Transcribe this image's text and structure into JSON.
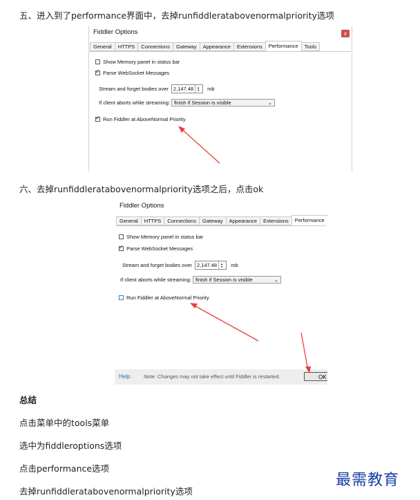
{
  "steps": {
    "five": "五、进入到了performance界面中，去掉runfiddleratabovenormalpriority选项",
    "six": "六、去掉runfiddleratabovenormalpriority选项之后，点击ok"
  },
  "dialog1": {
    "title": "Fiddler Options",
    "close": "x",
    "tabs": [
      "General",
      "HTTPS",
      "Connections",
      "Gateway",
      "Appearance",
      "Extensions",
      "Performance",
      "Tools"
    ],
    "show_memory": "Show Memory panel in status bar",
    "parse_ws": "Parse WebSocket Messages",
    "stream_label": "Stream and forget bodies over",
    "stream_value": "2,147.48",
    "stream_unit": "mb",
    "abort_label": "If client aborts while streaming:",
    "abort_value": "finish if Session is visible",
    "run_fiddler": "Run Fiddler at AboveNormal Priority"
  },
  "dialog2": {
    "title": "Fiddler Options",
    "tabs": [
      "General",
      "HTTPS",
      "Connections",
      "Gateway",
      "Appearance",
      "Extensions",
      "Performance"
    ],
    "show_memory": "Show Memory panel in status bar",
    "parse_ws": "Parse WebSocket Messages",
    "stream_label": "Stream and forget bodies over",
    "stream_value": "2,147.48",
    "stream_unit": "mb",
    "abort_label": "If client aborts while streaming:",
    "abort_value": "finish if Session is visible",
    "run_fiddler": "Run Fiddler at AboveNormal Priority",
    "help": "Help",
    "note": "Note: Changes may not take effect until Fiddler is restarted.",
    "ok": "OK"
  },
  "summary": {
    "title": "总结",
    "items": [
      "点击菜单中的tools菜单",
      "选中为fiddleroptions选项",
      "点击performance选项",
      "去掉runfiddleratabovenormalpriority选项"
    ]
  },
  "watermark": "最需教育",
  "colors": {
    "arrow": "#e8413c",
    "close": "#c75050",
    "watermark": "#1a3ea6"
  }
}
